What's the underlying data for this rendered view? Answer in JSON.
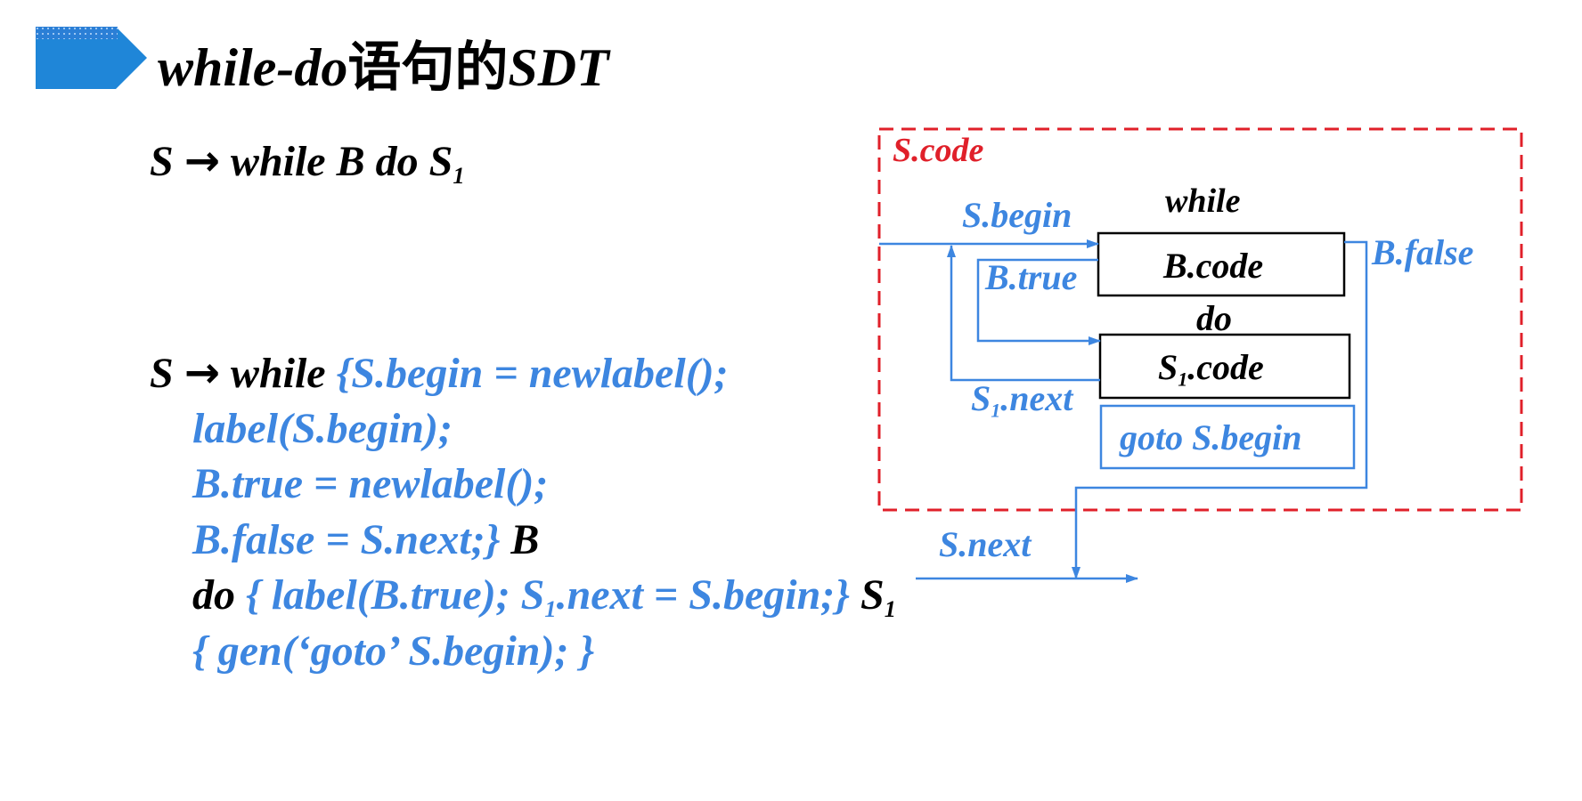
{
  "title": {
    "prefix": "while-do",
    "chinese": "语句的",
    "suffix": "SDT"
  },
  "production": {
    "lhs": "S",
    "arrow": "→",
    "rhs": "while B do S",
    "sub": "1"
  },
  "sdt": {
    "line1_head": "S",
    "line1_arrow": "→",
    "line1_kw": "while",
    "line1_action": "{S.begin = newlabel();",
    "line2": "label(S.begin);",
    "line3": "B.true = newlabel();",
    "line4_action": "B.false = S.next;}",
    "line4_sym": "B",
    "line5_kw": "do",
    "line5_action_a": "{ label(B.true); S",
    "line5_action_sub": "1",
    "line5_action_b": ".next = S.begin;}",
    "line5_sym": "S",
    "line5_sym_sub": "1",
    "line6": "{ gen(‘goto’ S.begin); }"
  },
  "diagram": {
    "scode": "S.code",
    "sbegin": "S.begin",
    "while": "while",
    "bcode": "B.code",
    "bfalse": "B.false",
    "btrue": "B.true",
    "do": "do",
    "s1code_s": "S",
    "s1code_sub": "1",
    "s1code_rest": ".code",
    "s1next_s": "S",
    "s1next_sub": "1",
    "s1next_rest": ".next",
    "goto": "goto S.begin",
    "snext": "S.next"
  },
  "colors": {
    "accent_blue": "#3d86e0",
    "marker_blue": "#1f6fc8",
    "frame_red": "#e0202a",
    "text_black": "#000000"
  }
}
